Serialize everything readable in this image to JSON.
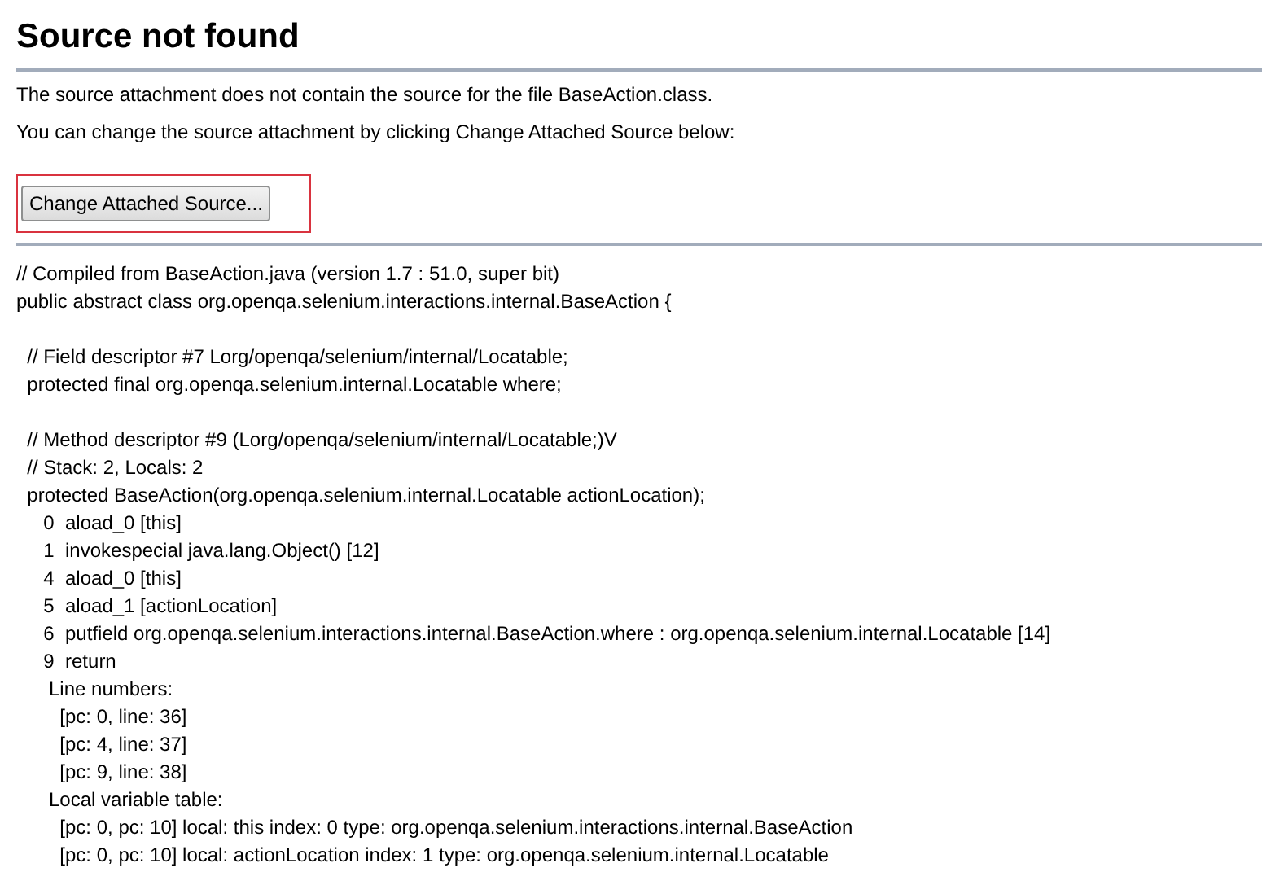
{
  "title": "Source not found",
  "messages": [
    "The source attachment does not contain the source for the file BaseAction.class.",
    "You can change the source attachment by clicking Change Attached Source below:"
  ],
  "button": {
    "label": "Change Attached Source...",
    "highlighted": true
  },
  "code_blocks": [
    [
      "// Compiled from BaseAction.java (version 1.7 : 51.0, super bit)",
      "public abstract class org.openqa.selenium.interactions.internal.BaseAction {"
    ],
    [
      "  // Field descriptor #7 Lorg/openqa/selenium/internal/Locatable;",
      "  protected final org.openqa.selenium.internal.Locatable where;"
    ],
    [
      "  // Method descriptor #9 (Lorg/openqa/selenium/internal/Locatable;)V",
      "  // Stack: 2, Locals: 2",
      "  protected BaseAction(org.openqa.selenium.internal.Locatable actionLocation);",
      "     0  aload_0 [this]",
      "     1  invokespecial java.lang.Object() [12]",
      "     4  aload_0 [this]",
      "     5  aload_1 [actionLocation]",
      "     6  putfield org.openqa.selenium.interactions.internal.BaseAction.where : org.openqa.selenium.internal.Locatable [14]",
      "     9  return",
      "      Line numbers:",
      "        [pc: 0, line: 36]",
      "        [pc: 4, line: 37]",
      "        [pc: 9, line: 38]",
      "      Local variable table:",
      "        [pc: 0, pc: 10] local: this index: 0 type: org.openqa.selenium.interactions.internal.BaseAction",
      "        [pc: 0, pc: 10] local: actionLocation index: 1 type: org.openqa.selenium.internal.Locatable"
    ]
  ]
}
